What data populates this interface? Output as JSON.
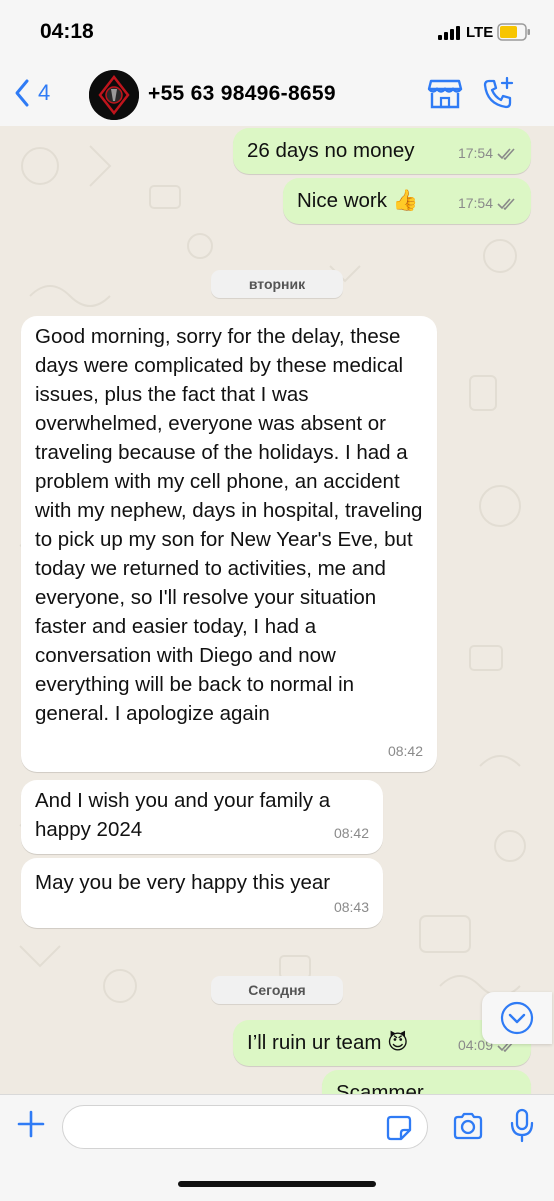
{
  "status": {
    "time": "04:18",
    "network": "LTE"
  },
  "header": {
    "back_count": "4",
    "contact_name": "+55 63 98496-8659"
  },
  "icons": {
    "back": "chevron-left-icon",
    "shop": "storefront-icon",
    "call": "phone-plus-icon",
    "scroll": "chevron-down-circle-icon",
    "plus": "plus-icon",
    "sticker": "sticker-icon",
    "camera": "camera-icon",
    "mic": "microphone-icon"
  },
  "colors": {
    "accent": "#2f7bf5",
    "outgoing_bubble": "#dcf7c5",
    "incoming_bubble": "#ffffff",
    "background": "#efeae2"
  },
  "messages": [
    {
      "direction": "outgoing",
      "text": "26 days no money",
      "time": "17:54",
      "status": "read"
    },
    {
      "direction": "outgoing",
      "text": "Nice work 👍",
      "time": "17:54",
      "status": "read"
    },
    {
      "type": "day",
      "label": "вторник"
    },
    {
      "direction": "incoming",
      "text": "Good morning, sorry for the delay, these days were complicated by these medical issues, plus the fact that I was overwhelmed, everyone was absent or traveling because of the holidays. I had a problem with my cell phone, an accident with my nephew, days in hospital, traveling to pick up my son for New Year's Eve, but today we returned to activities, me and everyone, so I'll resolve your situation faster and easier today, I had a conversation with Diego and now everything will be back to normal in general. I apologize again",
      "time": "08:42"
    },
    {
      "direction": "incoming",
      "text": "And I wish you and your family a happy 2024",
      "time": "08:42"
    },
    {
      "direction": "incoming",
      "text": "May you be very happy this year",
      "time": "08:43"
    },
    {
      "type": "day",
      "label": "Сегодня"
    },
    {
      "direction": "outgoing",
      "text": "I’ll ruin ur team 😈",
      "time": "04:09",
      "status": "read"
    },
    {
      "direction": "outgoing",
      "text": "Scammer",
      "partial": true
    }
  ],
  "composer": {
    "value": "",
    "placeholder": ""
  }
}
